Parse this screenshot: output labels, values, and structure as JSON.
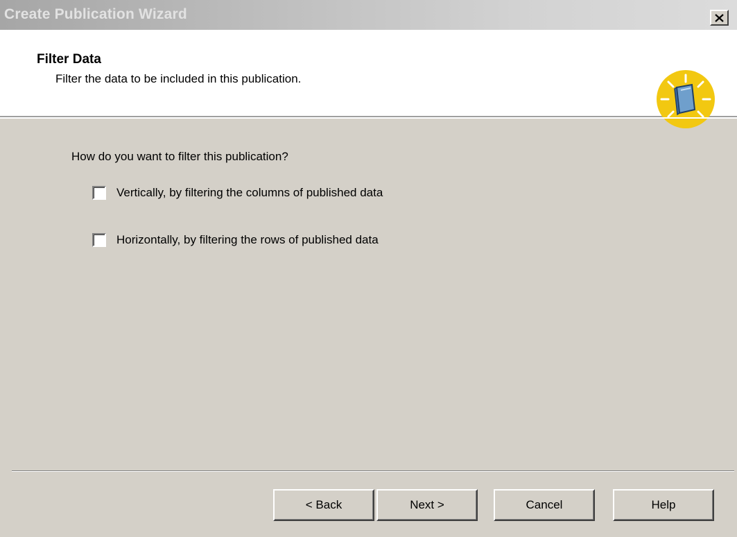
{
  "window": {
    "title": "Create Publication Wizard"
  },
  "header": {
    "title": "Filter Data",
    "subtitle": "Filter the data to be included in this publication.",
    "icon": "publication-book-icon"
  },
  "body": {
    "question": "How do you want to filter this publication?",
    "options": [
      {
        "label": "Vertically, by filtering the columns of published data",
        "checked": false
      },
      {
        "label": "Horizontally, by filtering the rows of published data",
        "checked": false
      }
    ]
  },
  "buttons": {
    "back": "< Back",
    "next": "Next >",
    "cancel": "Cancel",
    "help": "Help"
  },
  "colors": {
    "dialog_bg": "#d4d0c8",
    "header_bg": "#ffffff",
    "icon_yellow": "#f2c811",
    "icon_book_blue": "#6f9fcc"
  }
}
